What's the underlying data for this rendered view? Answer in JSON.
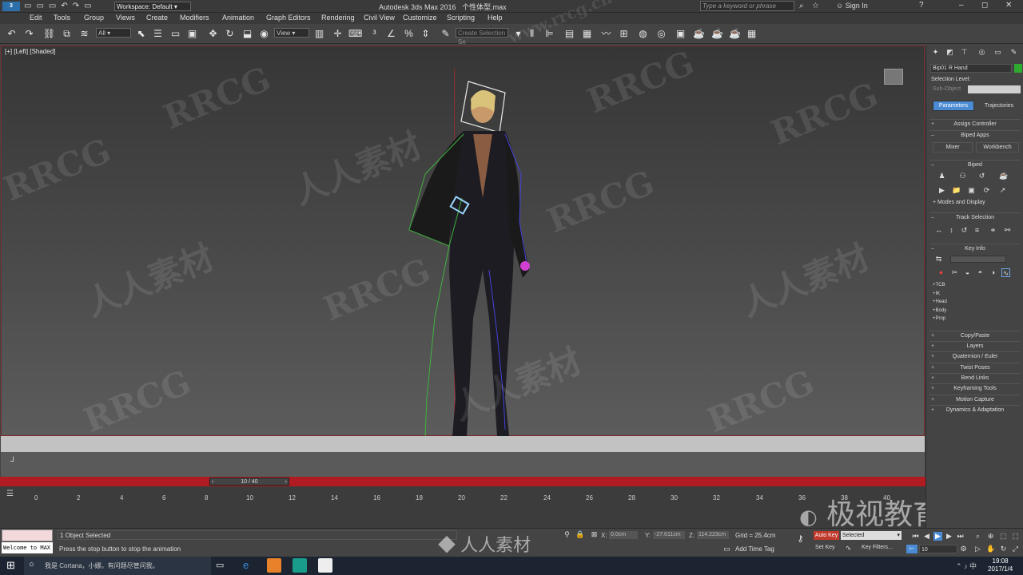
{
  "title": {
    "workspace": "Workspace: Default",
    "app": "Autodesk 3ds Max 2016",
    "file": "个性体型.max",
    "search_placeholder": "Type a keyword or phrase",
    "sign_in": "Sign In"
  },
  "menus": [
    "Edit",
    "Tools",
    "Group",
    "Views",
    "Create",
    "Modifiers",
    "Animation",
    "Graph Editors",
    "Rendering",
    "Civil View",
    "Customize",
    "Scripting",
    "Help"
  ],
  "toolbar": {
    "filter": "All",
    "refcoord": "View",
    "selset": "Create Selection Se"
  },
  "viewport": {
    "label": "[+] [Left] [Shaded]"
  },
  "time_slider": {
    "value": "10 / 40"
  },
  "timeline_ticks": [
    "0",
    "2",
    "4",
    "6",
    "8",
    "10",
    "12",
    "14",
    "16",
    "18",
    "20",
    "22",
    "24",
    "26",
    "28",
    "30",
    "32",
    "34",
    "36",
    "38",
    "40"
  ],
  "cmd": {
    "object_name": "Bip01 R Hand",
    "selection_level": "Selection Level:",
    "sub_object": "Sub-Object",
    "tabs": [
      "Parameters",
      "Trajectories"
    ],
    "assign_controller": "Assign Controller",
    "biped_apps": "Biped Apps",
    "mixer": "Mixer",
    "workbench": "Workbench",
    "biped": "Biped",
    "modes": "Modes and Display",
    "track_selection": "Track Selection",
    "key_info": "Key Info",
    "key_fields": [
      "TCB",
      "IK",
      "Head",
      "Body",
      "Prop"
    ],
    "rollouts": [
      "Copy/Paste",
      "Layers",
      "Quaternion / Euler",
      "Twist Poses",
      "Bend Links",
      "Keyframing Tools",
      "Motion Capture",
      "Dynamics & Adaptation"
    ]
  },
  "status": {
    "welcome": "Welcome to MAX",
    "objects_selected": "1 Object Selected",
    "prompt": "Press the stop button to stop the animation",
    "x_label": "X:",
    "x_val": "0.0cm",
    "y_label": "Y:",
    "y_val": "-27.611cm",
    "z_label": "Z:",
    "z_val": "114.223cm",
    "grid": "Grid = 25.4cm",
    "add_time_tag": "Add Time Tag",
    "auto_key": "Auto Key",
    "selected": "Selected",
    "set_key": "Set Key",
    "key_filters": "Key Filters...",
    "frame": "10"
  },
  "taskbar": {
    "search": "我是 Cortana，小娜。有问题尽管问我。",
    "time": "19:08",
    "date": "2017/1/4"
  },
  "watermarks": {
    "rrcg": "RRCG",
    "rrsc": "人人素材",
    "jiaoyu": "极视教育",
    "site": "www.rrcg.cn"
  },
  "colors": {
    "timeline_red": "#b01c22",
    "active_tab": "#4a8bd4",
    "auto_key_red": "#c0392b"
  }
}
